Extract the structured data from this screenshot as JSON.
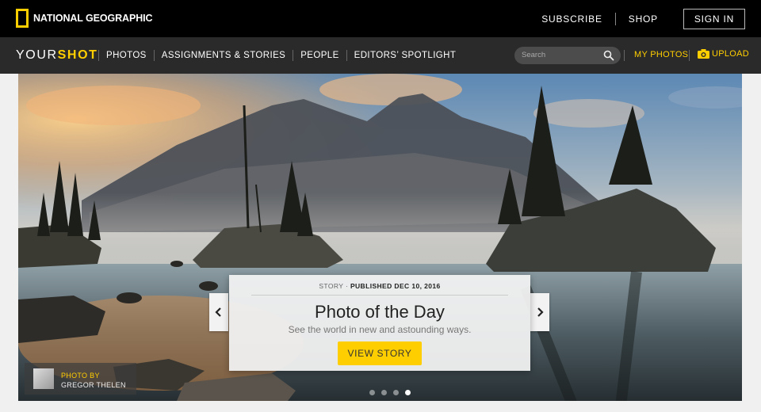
{
  "header": {
    "logo_text": "NATIONAL GEOGRAPHIC",
    "links": [
      {
        "label": "SUBSCRIBE"
      },
      {
        "label": "SHOP"
      }
    ],
    "signin_label": "SIGN IN"
  },
  "nav": {
    "brand_a": "YOUR",
    "brand_b": "SHOT",
    "items": [
      {
        "label": "PHOTOS"
      },
      {
        "label": "ASSIGNMENTS & STORIES"
      },
      {
        "label": "PEOPLE"
      },
      {
        "label": "EDITORS’ SPOTLIGHT"
      }
    ],
    "search": {
      "placeholder": "Search",
      "icon": "search-icon"
    },
    "my_photos_label": "MY PHOTOS",
    "upload_label": "UPLOAD",
    "upload_icon": "camera-icon"
  },
  "hero": {
    "story_type": "STORY",
    "published": "PUBLISHED DEC 10, 2016",
    "title": "Photo of the Day",
    "subtitle": "See the world in new and astounding ways.",
    "cta_label": "VIEW STORY",
    "credit_by": "PHOTO BY",
    "credit_name": "GREGOR THELEN",
    "carousel_count": 4,
    "carousel_active": 4
  },
  "colors": {
    "accent": "#ffce00",
    "topbar": "#000000",
    "navbar": "#2a2a2a"
  }
}
